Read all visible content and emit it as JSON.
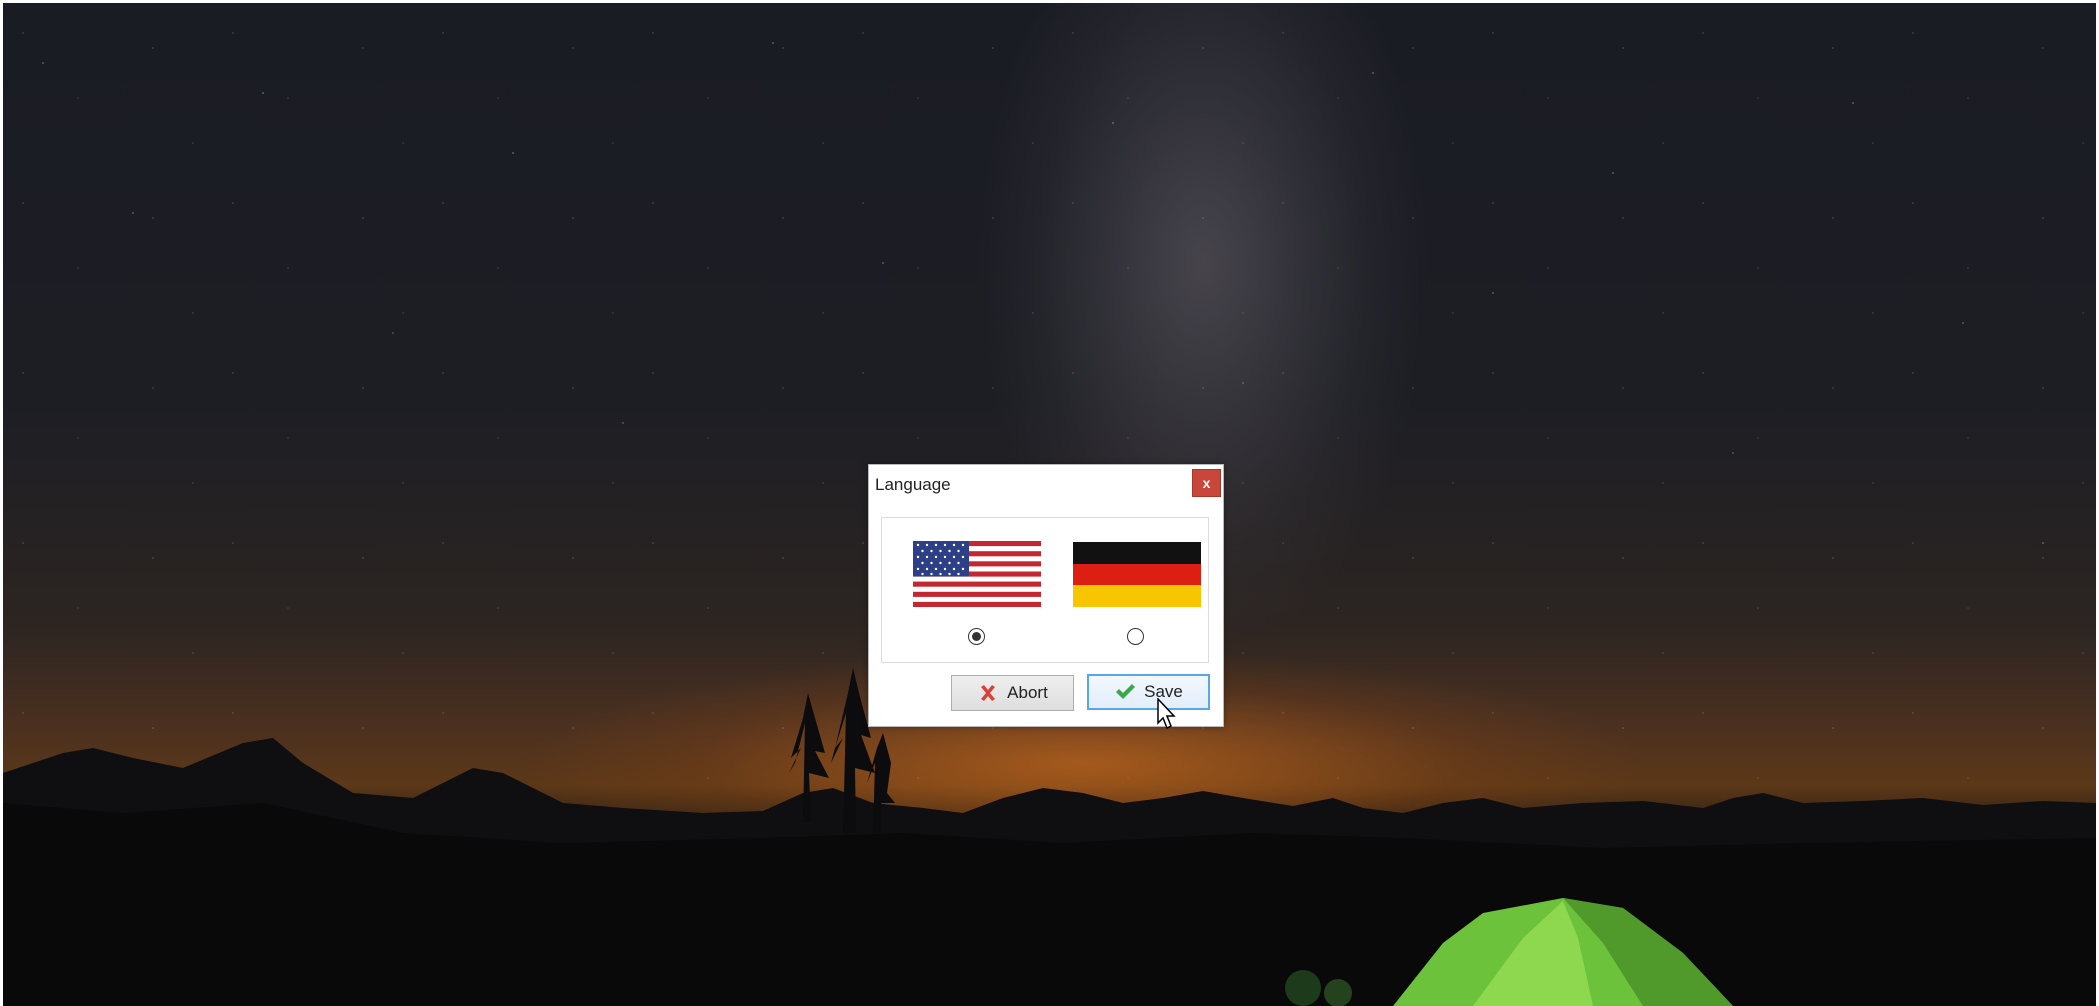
{
  "dialog": {
    "title": "Language",
    "close_label": "x"
  },
  "languages": [
    {
      "flag": "us-flag-icon",
      "selected": true
    },
    {
      "flag": "germany-flag-icon",
      "selected": false
    }
  ],
  "buttons": {
    "abort_label": "Abort",
    "save_label": "Save"
  },
  "colors": {
    "close_button": "#c8463a",
    "save_border": "#5aa7e6",
    "abort_icon": "#d9413a",
    "save_icon": "#3ca84a"
  }
}
